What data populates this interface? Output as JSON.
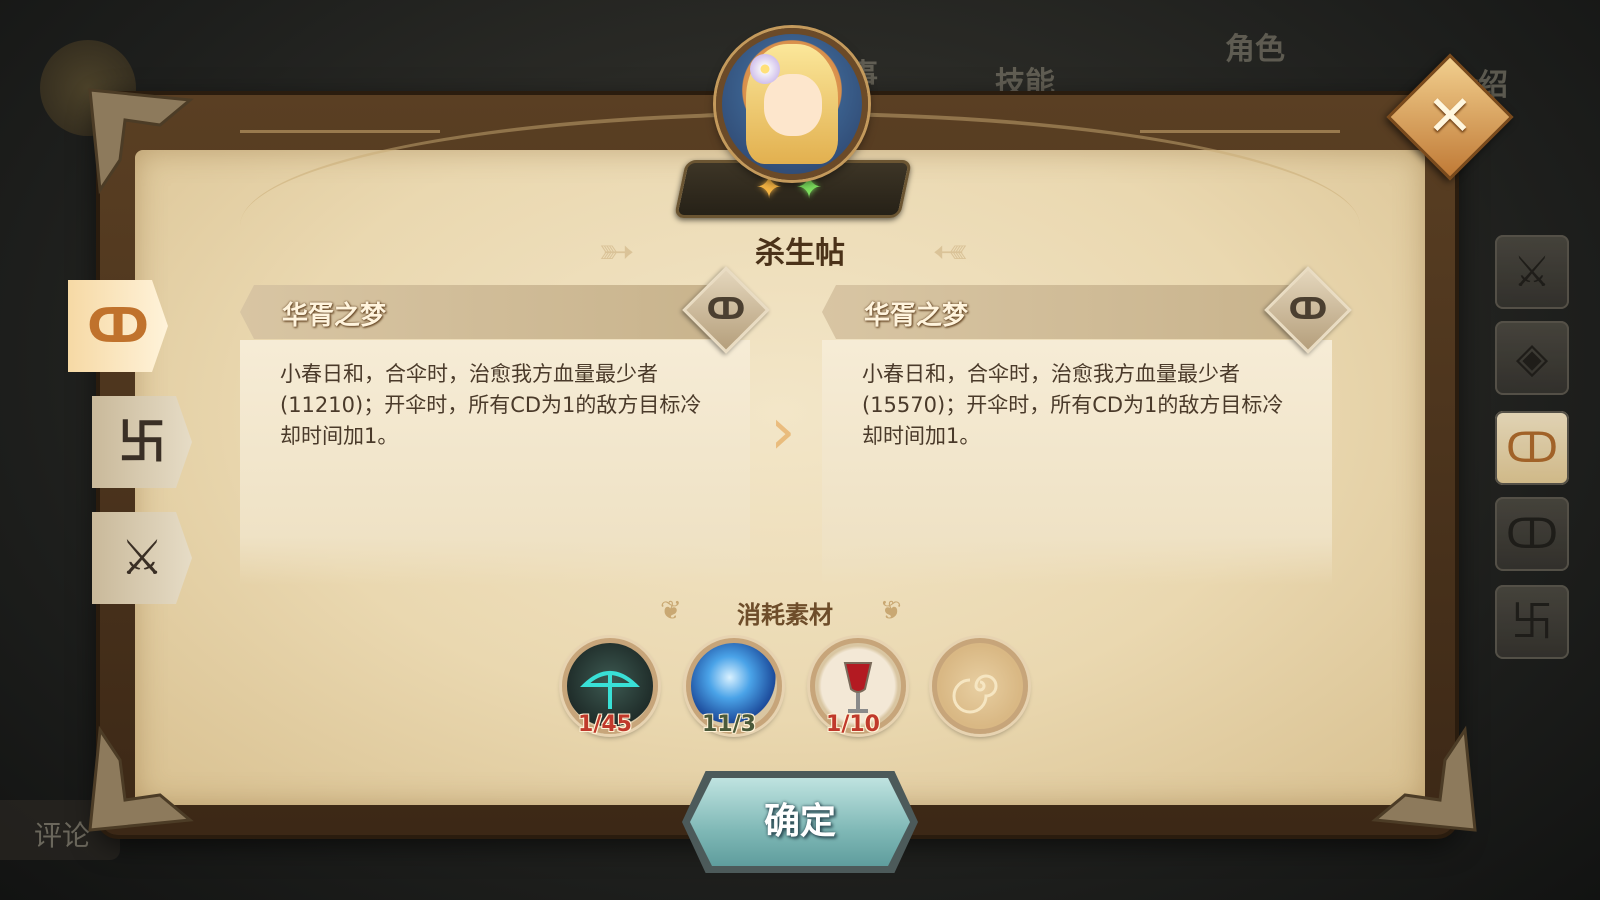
{
  "background": {
    "tabs": [
      "技能",
      "角色"
    ],
    "partial_left": "事",
    "partial_right": "介绍",
    "comment_label": "评论"
  },
  "dialog": {
    "title": "杀生帖",
    "stars": [
      "✦",
      "✦"
    ],
    "star_colors": [
      "#f5b443",
      "#7ee15f"
    ],
    "left_tabs": [
      {
        "icon": "ↀ",
        "icon_name": "skill-swirl-icon",
        "active": true
      },
      {
        "icon": "卐",
        "icon_name": "pattern-icon",
        "active": false
      },
      {
        "icon": "⚔",
        "icon_name": "crossed-swords-icon",
        "active": false
      }
    ],
    "right_strip": [
      {
        "icon": "⚔",
        "icon_name": "crossed-swords-icon",
        "active": false
      },
      {
        "icon": "◈",
        "icon_name": "diamond-emblem-icon",
        "active": false
      },
      {
        "icon": "ↀ",
        "icon_name": "flame-swirl-icon",
        "active": true
      },
      {
        "icon": "ↀ",
        "icon_name": "swirl-icon",
        "active": false
      },
      {
        "icon": "卐",
        "icon_name": "pattern-icon",
        "active": false
      }
    ],
    "current_skill": {
      "name": "华胥之梦",
      "desc": "小春日和，合伞时，治愈我方血量最少者(11210)；开伞时，所有CD为1的敌方目标冷却时间加1。",
      "icon": "ↀ"
    },
    "next_skill": {
      "name": "华胥之梦",
      "desc": "小春日和，合伞时，治愈我方血量最少者(15570)；开伞时，所有CD为1的敌方目标冷却时间加1。",
      "icon": "ↀ"
    },
    "materials_title": "消耗素材",
    "materials": [
      {
        "name": "umbrella-stone",
        "count": "1/45",
        "count_color": "#c0392b"
      },
      {
        "name": "blue-orb",
        "count": "11/3",
        "count_color": "#4a5a3a"
      },
      {
        "name": "red-goblet",
        "count": "1/10",
        "count_color": "#c0392b"
      },
      {
        "name": "gold-swirl-coin",
        "count": "",
        "count_color": "#4a5a3a"
      }
    ],
    "confirm_label": "确定",
    "close_icon": "✕"
  }
}
